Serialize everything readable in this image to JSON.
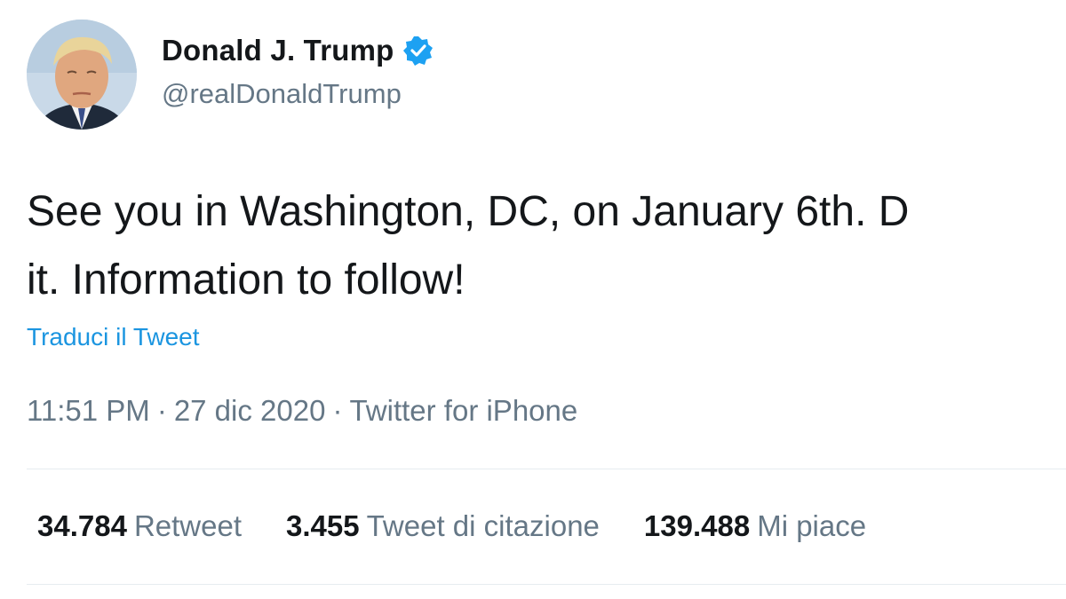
{
  "author": {
    "display_name": "Donald J. Trump",
    "handle": "@realDonaldTrump",
    "verified": true,
    "verified_icon": "verified-badge-icon",
    "avatar_icon": "profile-avatar"
  },
  "tweet": {
    "text_line1": "See you in Washington, DC, on January 6th. D",
    "text_line2": "it. Information to follow!",
    "translate_label": "Traduci il Tweet",
    "time": "11:51 PM",
    "separator": "·",
    "date": "27 dic 2020",
    "source": "Twitter for iPhone"
  },
  "stats": [
    {
      "count": "34.784",
      "label": "Retweet"
    },
    {
      "count": "3.455",
      "label": "Tweet di citazione"
    },
    {
      "count": "139.488",
      "label": "Mi piace"
    }
  ],
  "colors": {
    "link_blue": "#1b95e0",
    "verified_blue": "#1da1f2",
    "text_primary": "#14171a",
    "text_secondary": "#657786",
    "divider": "#e6ecf0"
  }
}
